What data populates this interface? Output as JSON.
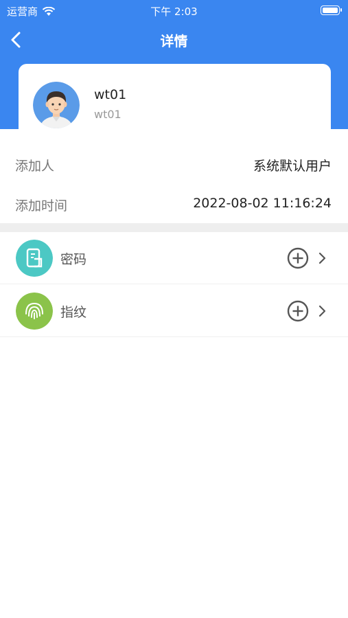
{
  "status_bar": {
    "carrier": "运营商",
    "time": "下午 2:03"
  },
  "nav": {
    "title": "详情"
  },
  "user": {
    "name": "wt01",
    "subname": "wt01"
  },
  "info": [
    {
      "label": "添加人",
      "value": "系统默认用户"
    },
    {
      "label": "添加时间",
      "value": "2022-08-02 11:16:24"
    }
  ],
  "credentials": [
    {
      "label": "密码",
      "icon": "password-card-icon",
      "color": "#4cc8c4"
    },
    {
      "label": "指纹",
      "icon": "fingerprint-icon",
      "color": "#8bc34a"
    }
  ],
  "colors": {
    "header": "#3a86f0",
    "divider": "#eeeeee"
  }
}
